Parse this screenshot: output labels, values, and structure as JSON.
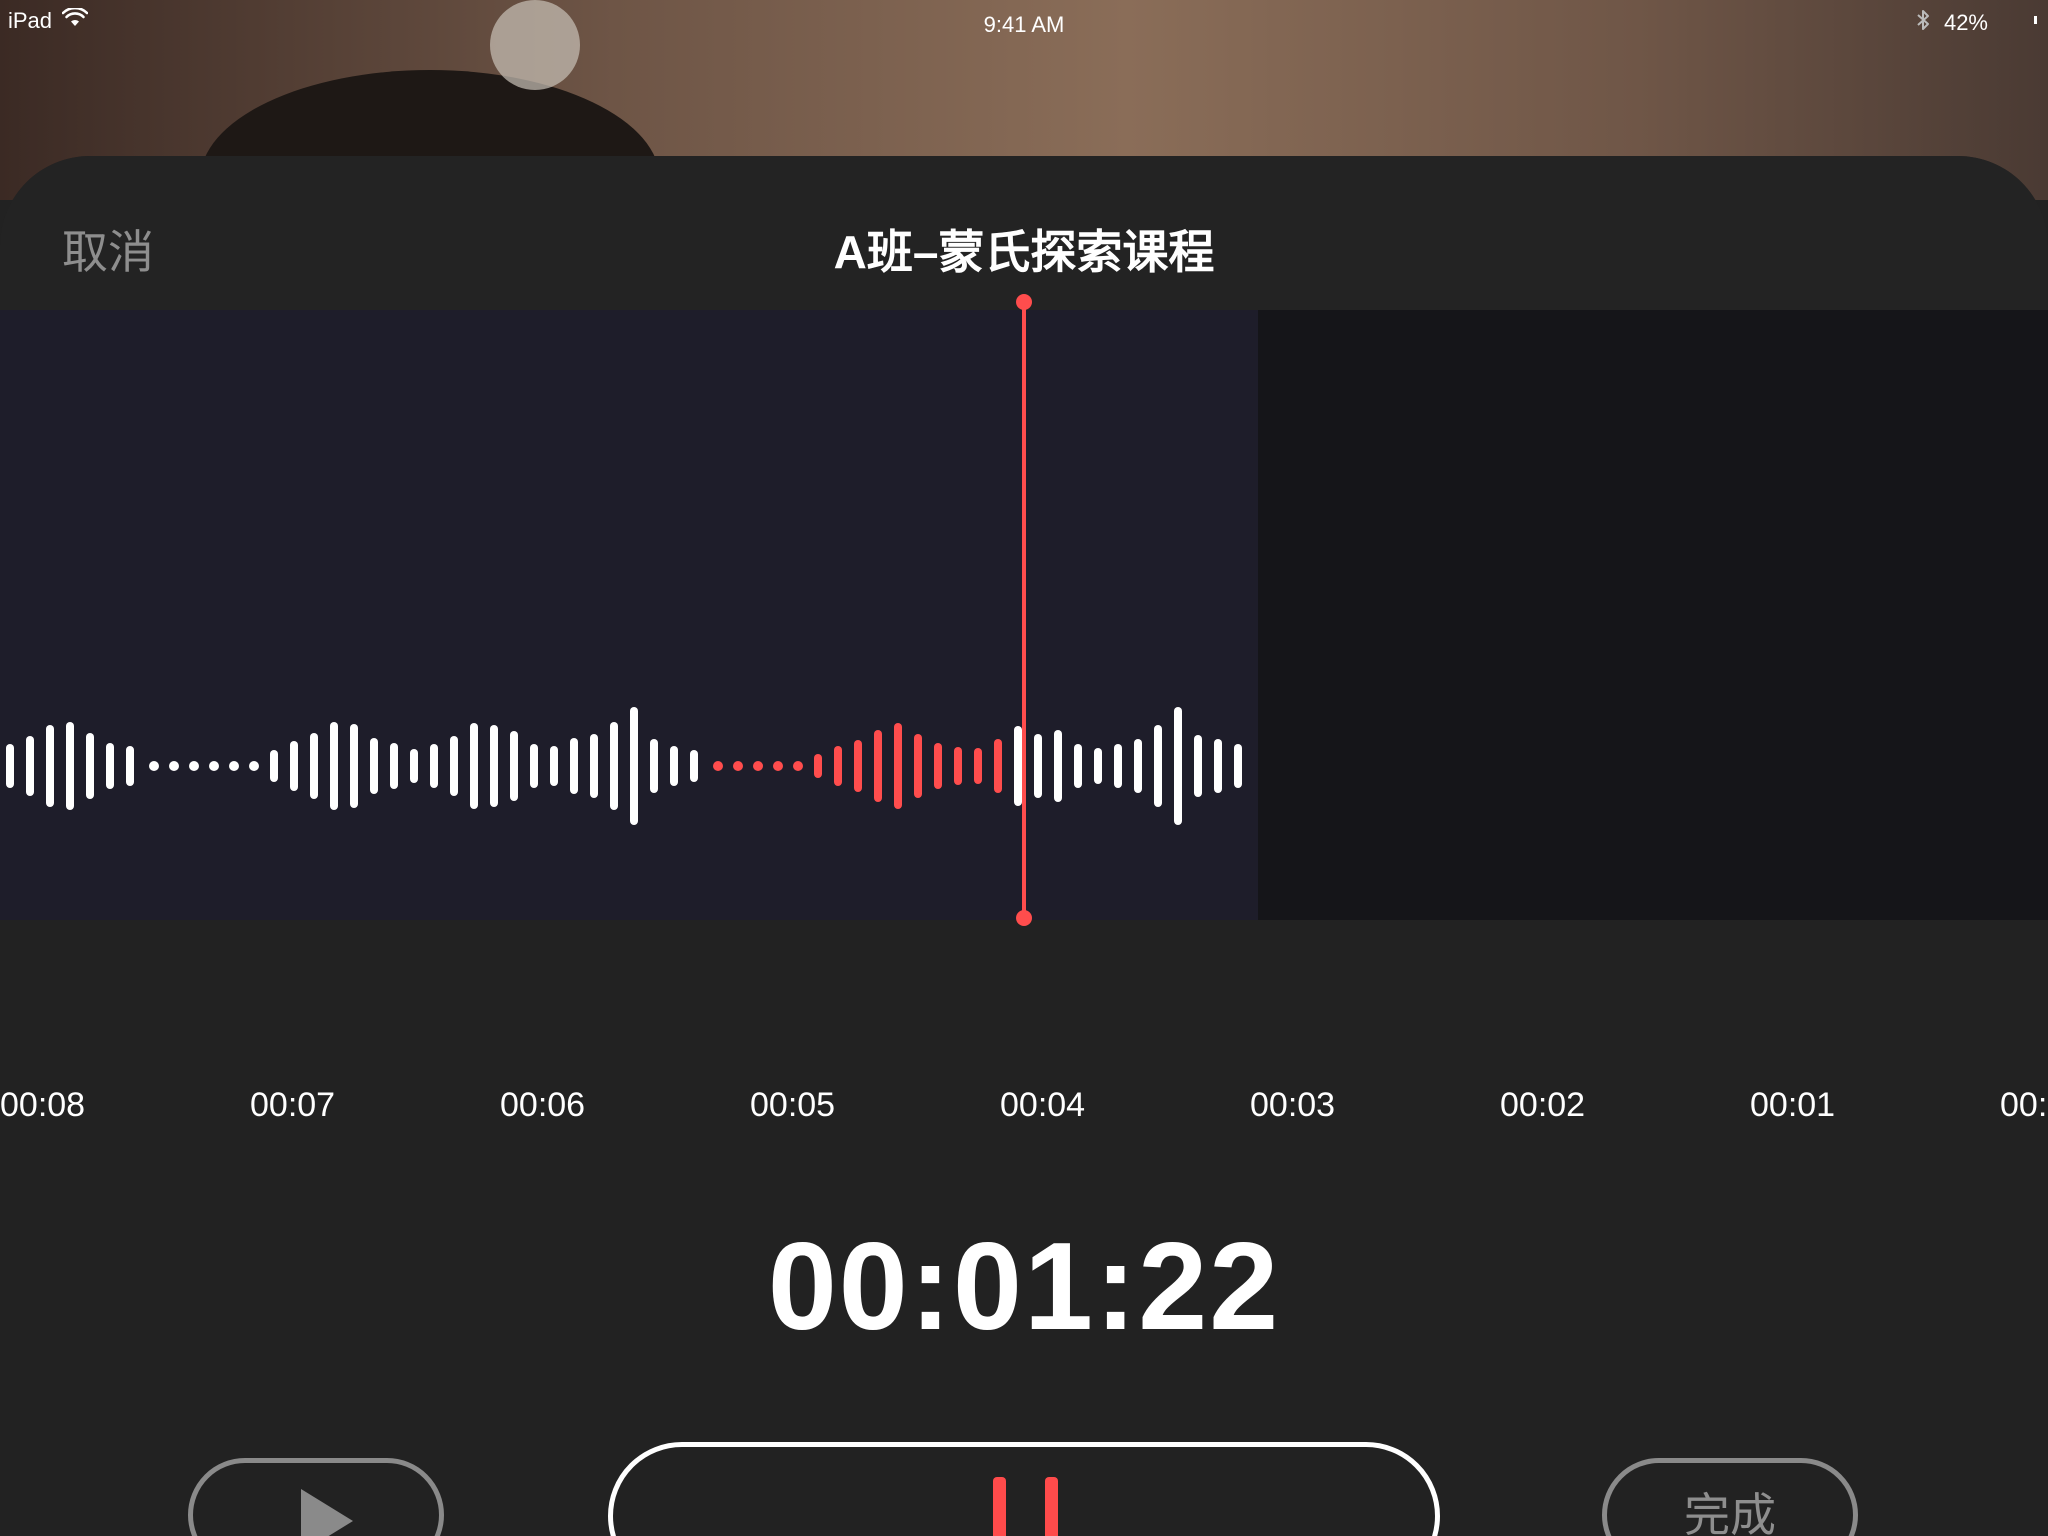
{
  "status_bar": {
    "device": "iPad",
    "time": "9:41 AM",
    "battery": "42%",
    "icons": [
      "wifi-icon",
      "bluetooth-icon",
      "battery-icon"
    ]
  },
  "nav": {
    "cancel_label": "取消",
    "title": "A班–蒙氏探索课程"
  },
  "timeline": {
    "labels": [
      "00:08",
      "00:07",
      "00:06",
      "00:05",
      "00:04",
      "00:03",
      "00:02",
      "00:01",
      "00:0"
    ]
  },
  "timer": "00:01:22",
  "controls": {
    "play_icon": "play-icon",
    "pause_icon": "pause-icon",
    "done_label": "完成"
  },
  "colors": {
    "accent_red": "#ff4d4d",
    "recorded_bg": "#1e1d2a",
    "empty_bg": "#151519",
    "sheet_bg": "#222222",
    "muted_gray": "#8e8e8e"
  }
}
